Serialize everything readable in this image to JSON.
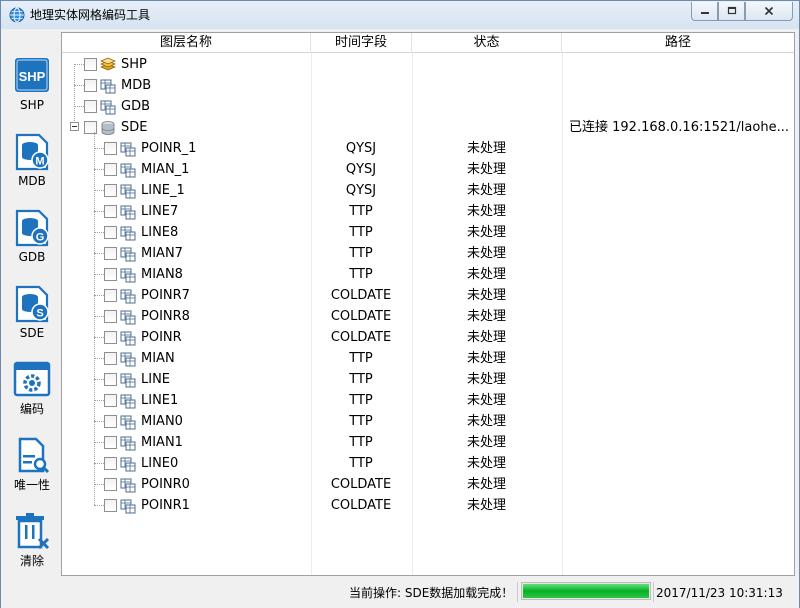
{
  "window": {
    "title": "地理实体网格编码工具"
  },
  "toolbar": [
    {
      "key": "shp",
      "label": "SHP",
      "icon": "shp-icon"
    },
    {
      "key": "mdb",
      "label": "MDB",
      "icon": "mdb-database-icon"
    },
    {
      "key": "gdb",
      "label": "GDB",
      "icon": "gdb-database-icon"
    },
    {
      "key": "sde",
      "label": "SDE",
      "icon": "sde-database-icon"
    },
    {
      "key": "encode",
      "label": "编码",
      "icon": "encode-gear-icon"
    },
    {
      "key": "unique",
      "label": "唯一性",
      "icon": "unique-search-icon"
    },
    {
      "key": "clear",
      "label": "清除",
      "icon": "clear-trash-icon"
    }
  ],
  "grid": {
    "columns": [
      "图层名称",
      "时间字段",
      "状态",
      "路径"
    ],
    "groups": [
      {
        "name": "SHP",
        "icon": "shp-layers-icon",
        "path": ""
      },
      {
        "name": "MDB",
        "icon": "mdb-table-icon",
        "path": ""
      },
      {
        "name": "GDB",
        "icon": "gdb-table-icon",
        "path": ""
      },
      {
        "name": "SDE",
        "icon": "sde-server-icon",
        "path": "已连接 192.168.0.16:1521/laohe..."
      }
    ],
    "layers": [
      {
        "name": "POINR_1",
        "time": "QYSJ",
        "status": "未处理"
      },
      {
        "name": "MIAN_1",
        "time": "QYSJ",
        "status": "未处理"
      },
      {
        "name": "LINE_1",
        "time": "QYSJ",
        "status": "未处理"
      },
      {
        "name": "LINE7",
        "time": "TTP",
        "status": "未处理"
      },
      {
        "name": "LINE8",
        "time": "TTP",
        "status": "未处理"
      },
      {
        "name": "MIAN7",
        "time": "TTP",
        "status": "未处理"
      },
      {
        "name": "MIAN8",
        "time": "TTP",
        "status": "未处理"
      },
      {
        "name": "POINR7",
        "time": "COLDATE",
        "status": "未处理"
      },
      {
        "name": "POINR8",
        "time": "COLDATE",
        "status": "未处理"
      },
      {
        "name": "POINR",
        "time": "COLDATE",
        "status": "未处理"
      },
      {
        "name": "MIAN",
        "time": "TTP",
        "status": "未处理"
      },
      {
        "name": "LINE",
        "time": "TTP",
        "status": "未处理"
      },
      {
        "name": "LINE1",
        "time": "TTP",
        "status": "未处理"
      },
      {
        "name": "MIAN0",
        "time": "TTP",
        "status": "未处理"
      },
      {
        "name": "MIAN1",
        "time": "TTP",
        "status": "未处理"
      },
      {
        "name": "LINE0",
        "time": "TTP",
        "status": "未处理"
      },
      {
        "name": "POINR0",
        "time": "COLDATE",
        "status": "未处理"
      },
      {
        "name": "POINR1",
        "time": "COLDATE",
        "status": "未处理"
      }
    ]
  },
  "status": {
    "operation": "当前操作: SDE数据加载完成！",
    "progress": 1.0,
    "datetime": "2017/11/23 10:31:13"
  },
  "colors": {
    "icon_blue": "#1e73be",
    "progress_green": "#06b025"
  }
}
